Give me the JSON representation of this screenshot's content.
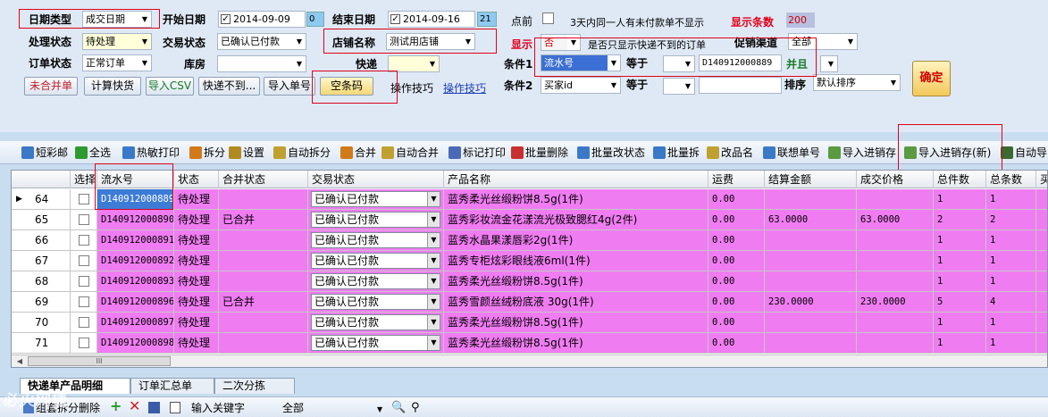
{
  "filters": {
    "date_type_label": "日期类型",
    "date_type_value": "成交日期",
    "start_date_label": "开始日期",
    "start_date_value": "2014-09-09",
    "start_spin_value": "0",
    "end_date_label": "结束日期",
    "end_date_value": "2014-09-16",
    "end_spin_value": "21",
    "dot_front_label": "点前",
    "unpaid_hint": "3天内同一人有未付款单不显示",
    "show_count_label": "显示条数",
    "show_count_value": "200",
    "process_status_label": "处理状态",
    "process_status_value": "待处理",
    "trade_status_label": "交易状态",
    "trade_status_value": "已确认已付款",
    "shop_label": "店铺名称",
    "shop_value": "测试用店铺",
    "display_label": "显示",
    "display_value": "否",
    "display_hint": "是否只显示快递不到的订单",
    "promo_channel_label": "促销渠道",
    "promo_channel_value": "全部",
    "order_status_label": "订单状态",
    "order_status_value": "正常订单",
    "warehouse_label": "库房",
    "warehouse_value": "",
    "express_label": "快递",
    "express_value": "",
    "cond1_label": "条件1",
    "cond1_field": "流水号",
    "cond1_op": "等于",
    "cond1_value": "D140912000889",
    "and_label": "并且",
    "cond2_label": "条件2",
    "cond2_field": "买家id",
    "cond2_op": "等于",
    "cond2_value": "",
    "sort_label": "排序",
    "sort_value": "默认排序",
    "confirm_button": "确定"
  },
  "buttons": {
    "unmerge": "未合并单",
    "calc_freight": "计算快货",
    "import_csv": "导入CSV",
    "express_unreachable": "快递不到...",
    "import_order": "导入单号",
    "empty_barcode": "空条码",
    "tips_text": "操作技巧",
    "tips_link": "操作技巧"
  },
  "toolbar": [
    {
      "label": "短彩邮",
      "icon": "message-icon",
      "color": "#3a78c8"
    },
    {
      "label": "全选",
      "icon": "check-icon",
      "color": "#2e9a2e"
    },
    {
      "label": "热敏打印",
      "icon": "print-icon",
      "color": "#3a78c8"
    },
    {
      "label": "拆分",
      "icon": "split-icon",
      "color": "#d07a1a"
    },
    {
      "label": "设置",
      "icon": "settings-icon",
      "color": "#b08a20"
    },
    {
      "label": "自动拆分",
      "icon": "auto-split-icon",
      "color": "#c0a030"
    },
    {
      "label": "合并",
      "icon": "merge-icon",
      "color": "#d07a1a"
    },
    {
      "label": "自动合并",
      "icon": "auto-merge-icon",
      "color": "#c0a030"
    },
    {
      "label": "标记打印",
      "icon": "mark-print-icon",
      "color": "#4a6ab8"
    },
    {
      "label": "批量删除",
      "icon": "batch-delete-icon",
      "color": "#c83030"
    },
    {
      "label": "批量改状态",
      "icon": "batch-status-icon",
      "color": "#3a78c8"
    },
    {
      "label": "批量拆",
      "icon": "batch-split-icon",
      "color": "#3a78c8"
    },
    {
      "label": "改品名",
      "icon": "rename-icon",
      "color": "#c0a030"
    },
    {
      "label": "联想单号",
      "icon": "link-order-icon",
      "color": "#3a78c8"
    },
    {
      "label": "导入进销存",
      "icon": "import-inventory-icon",
      "color": "#5a9a40"
    },
    {
      "label": "导入进销存(新)",
      "icon": "import-inventory-new-icon",
      "color": "#5a9a40"
    },
    {
      "label": "自动导",
      "icon": "auto-import-icon",
      "color": "#3a6a30"
    }
  ],
  "grid": {
    "headers": [
      "选择",
      "流水号",
      "状态",
      "合并状态",
      "交易状态",
      "产品名称",
      "运费",
      "结算金额",
      "成交价格",
      "总件数",
      "总条数",
      "买"
    ],
    "rows": [
      {
        "index": "64",
        "serial": "D140912000889",
        "status": "待处理",
        "merge": "",
        "trade": "已确认已付款",
        "product": "蓝秀柔光丝缎粉饼8.5g(1件)",
        "freight": "0.00",
        "settle": "",
        "price": "",
        "pieces": "1",
        "count": "1"
      },
      {
        "index": "65",
        "serial": "D140912000890",
        "status": "待处理",
        "merge": "已合并",
        "trade": "已确认已付款",
        "product": "蓝秀彩妆流金花漾流光极致腮红4g(2件)",
        "freight": "0.00",
        "settle": "63.0000",
        "price": "63.0000",
        "pieces": "2",
        "count": "2"
      },
      {
        "index": "66",
        "serial": "D140912000891",
        "status": "待处理",
        "merge": "",
        "trade": "已确认已付款",
        "product": "蓝秀水晶果漾唇彩2g(1件)",
        "freight": "0.00",
        "settle": "",
        "price": "",
        "pieces": "1",
        "count": "1"
      },
      {
        "index": "67",
        "serial": "D140912000892",
        "status": "待处理",
        "merge": "",
        "trade": "已确认已付款",
        "product": "蓝秀专柜炫彩眼线液6ml(1件)",
        "freight": "0.00",
        "settle": "",
        "price": "",
        "pieces": "1",
        "count": "1"
      },
      {
        "index": "68",
        "serial": "D140912000893",
        "status": "待处理",
        "merge": "",
        "trade": "已确认已付款",
        "product": "蓝秀柔光丝缎粉饼8.5g(1件)",
        "freight": "0.00",
        "settle": "",
        "price": "",
        "pieces": "1",
        "count": "1"
      },
      {
        "index": "69",
        "serial": "D140912000896",
        "status": "待处理",
        "merge": "已合并",
        "trade": "已确认已付款",
        "product": "蓝秀雪颜丝绒粉底液 30g(1件)",
        "freight": "0.00",
        "settle": "230.0000",
        "price": "230.0000",
        "pieces": "5",
        "count": "4"
      },
      {
        "index": "70",
        "serial": "D140912000897",
        "status": "待处理",
        "merge": "",
        "trade": "已确认已付款",
        "product": "蓝秀柔光丝缎粉饼8.5g(1件)",
        "freight": "0.00",
        "settle": "",
        "price": "",
        "pieces": "1",
        "count": "1"
      },
      {
        "index": "71",
        "serial": "D140912000898",
        "status": "待处理",
        "merge": "",
        "trade": "已确认已付款",
        "product": "蓝秀柔光丝缎粉饼8.5g(1件)",
        "freight": "0.00",
        "settle": "",
        "price": "",
        "pieces": "1",
        "count": "1"
      }
    ],
    "scroll_thumb": "III"
  },
  "tabs": [
    "快递单产品明细",
    "订单汇总单",
    "二次分拣"
  ],
  "bottombar": {
    "split_delete": "组套拆分删除",
    "keyword_label": "输入关键字",
    "scope_value": "全部"
  },
  "watermark": "必火网捷",
  "colors": {
    "row_pink": "#f07cf2",
    "highlight_red": "#e0001a",
    "selected_blue": "#3c7bd6"
  }
}
